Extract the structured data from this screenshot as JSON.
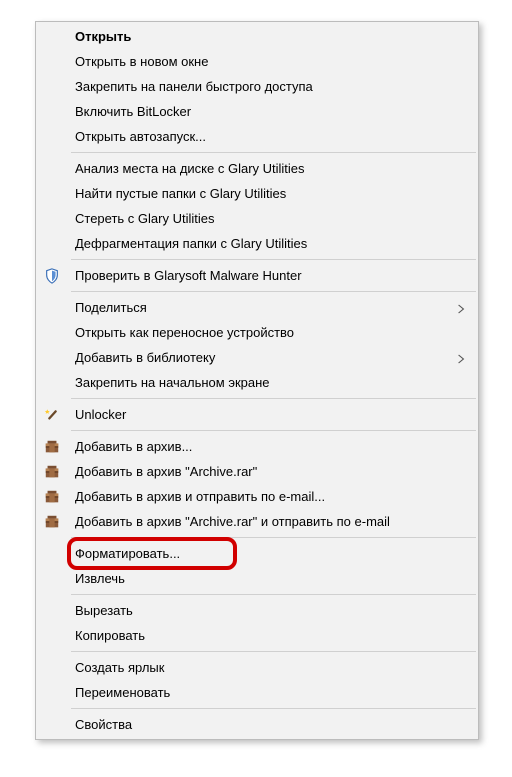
{
  "menu": {
    "open": "Открыть",
    "open_new_window": "Открыть в новом окне",
    "pin_quick_access": "Закрепить на панели быстрого доступа",
    "enable_bitlocker": "Включить BitLocker",
    "open_autorun": "Открыть автозапуск...",
    "glary_disk_analysis": "Анализ места на диске с Glary Utilities",
    "glary_find_empty": "Найти пустые папки с Glary Utilities",
    "glary_erase": "Стереть с Glary Utilities",
    "glary_defrag": "Дефрагментация папки с Glary Utilities",
    "glarysoft_check": "Проверить в Glarysoft Malware Hunter",
    "share": "Поделиться",
    "open_portable": "Открыть как переносное устройство",
    "add_library": "Добавить в библиотеку",
    "pin_start": "Закрепить на начальном экране",
    "unlocker": "Unlocker",
    "add_archive": "Добавить в архив...",
    "add_archive_rar": "Добавить в архив \"Archive.rar\"",
    "add_email": "Добавить в архив и отправить по e-mail...",
    "add_rar_email": "Добавить в архив \"Archive.rar\" и отправить по e-mail",
    "format": "Форматировать...",
    "extract": "Извлечь",
    "cut": "Вырезать",
    "copy": "Копировать",
    "create_shortcut": "Создать ярлык",
    "rename": "Переименовать",
    "properties": "Свойства"
  },
  "highlight": {
    "target": "format"
  }
}
